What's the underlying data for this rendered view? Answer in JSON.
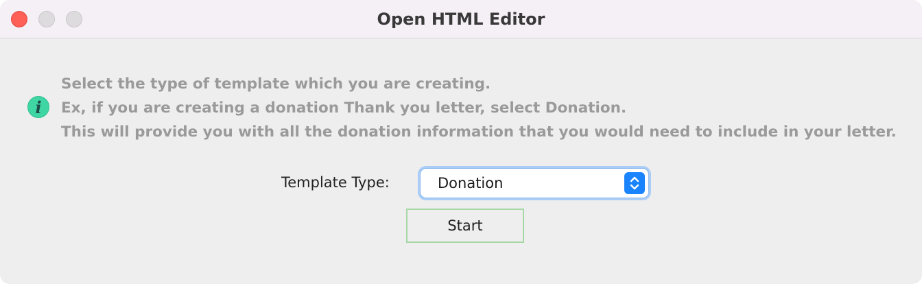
{
  "window": {
    "title": "Open HTML Editor",
    "controls": [
      "close-icon",
      "minimize-icon",
      "zoom-icon"
    ]
  },
  "info": {
    "icon": "info-icon",
    "icon_glyph": "i",
    "lines": [
      "Select the type of template which you are creating.",
      "Ex, if you are creating a donation Thank you letter, select Donation.",
      "This will provide you with all the donation information that you would need to include in your letter."
    ]
  },
  "form": {
    "template_type_label": "Template Type:",
    "template_type_value": "Donation",
    "start_label": "Start"
  },
  "colors": {
    "close": "#fe5f57",
    "info_icon": "#3fd6a4",
    "select_accent": "#1a84ff",
    "focus_ring": "#a9cdf7",
    "button_border": "#a6d8a6"
  }
}
